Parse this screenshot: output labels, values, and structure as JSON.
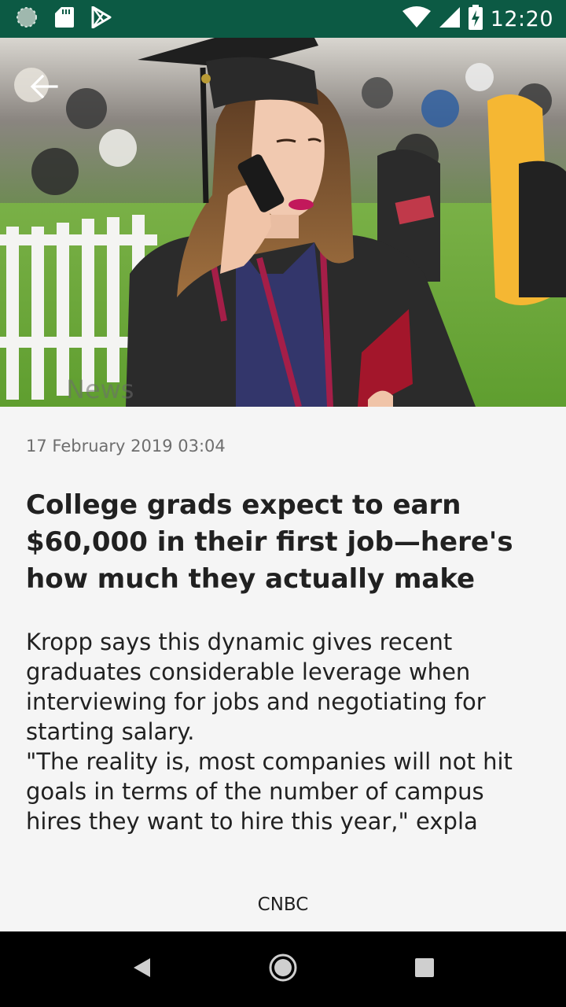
{
  "status_bar": {
    "time": "12:20",
    "icons": [
      "sync-icon",
      "sd-card-icon",
      "play-store-icon",
      "wifi-icon",
      "signal-icon",
      "battery-charging-icon"
    ]
  },
  "hero": {
    "watermark": "News",
    "back_icon": "arrow-back-icon"
  },
  "article": {
    "date": "17 February 2019 03:04",
    "headline": "College grads expect to earn $60,000 in their first job—here's how much they actually make",
    "body": "Kropp says this dynamic gives recent graduates considerable leverage when interviewing for jobs and negotiating for starting salary.\n\"The reality is, most companies will not hit goals in terms of the number of campus hires they want to hire this year,\" expla",
    "source": "CNBC"
  },
  "nav_bar": {
    "icons": [
      "back-triangle-icon",
      "home-circle-icon",
      "recents-square-icon"
    ]
  },
  "colors": {
    "status_bar": "#0c5a44",
    "background": "#f5f5f5",
    "text": "#212121",
    "muted_text": "#6e6e6e"
  }
}
